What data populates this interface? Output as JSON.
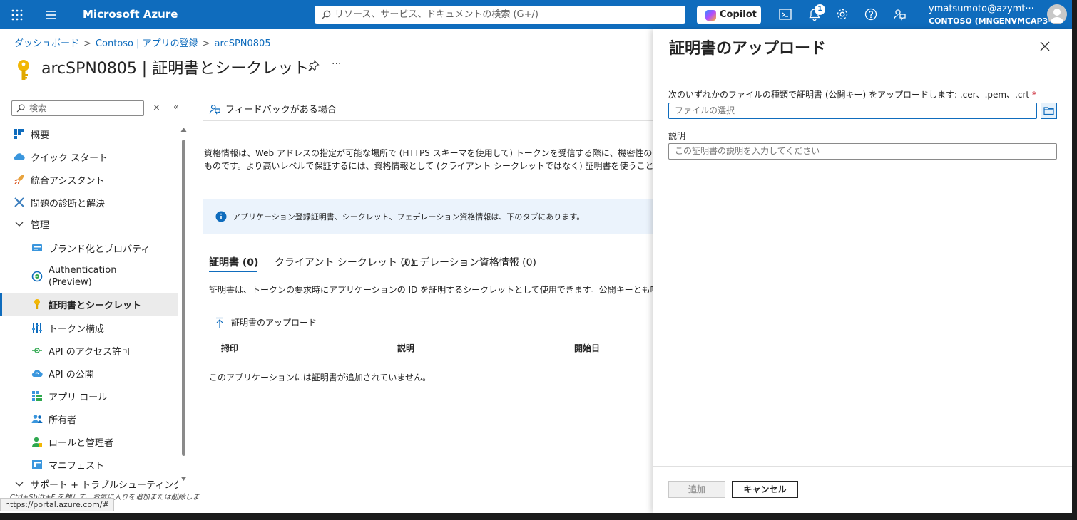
{
  "topbar": {
    "brand": "Microsoft Azure",
    "search_placeholder": "リソース、サービス、ドキュメントの検索 (G+/)",
    "copilot_label": "Copilot",
    "notification_count": "1",
    "user_name": "ymatsumoto@azymt···",
    "user_org": "CONTOSO (MNGENVMCAP3···"
  },
  "breadcrumb": {
    "items": [
      "ダッシュボード",
      "Contoso | アプリの登録",
      "arcSPN0805"
    ],
    "separator": ">"
  },
  "page": {
    "title": "arcSPN0805 | 証明書とシークレット",
    "more": "···"
  },
  "nav": {
    "search_placeholder": "検索",
    "clear": "×",
    "collapse": "«",
    "items": [
      {
        "label": "概要"
      },
      {
        "label": "クイック スタート"
      },
      {
        "label": "統合アシスタント"
      },
      {
        "label": "問題の診断と解決"
      },
      {
        "label": "管理"
      },
      {
        "label": "ブランド化とプロパティ"
      },
      {
        "label": "Authentication"
      },
      {
        "label": "(Preview)"
      },
      {
        "label": "証明書とシークレット"
      },
      {
        "label": "トークン構成"
      },
      {
        "label": "API のアクセス許可"
      },
      {
        "label": "API の公開"
      },
      {
        "label": "アプリ ロール"
      },
      {
        "label": "所有者"
      },
      {
        "label": "ロールと管理者"
      },
      {
        "label": "マニフェスト"
      },
      {
        "label": "サポート + トラブルシューティング"
      }
    ],
    "hint": "Ctrl+Shift+F を押して、お気に入りを追加または削除しま"
  },
  "statusbar": {
    "url": "https://portal.azure.com/#"
  },
  "main": {
    "feedback": "フィードバックがある場合",
    "description_line1": "資格情報は、Web アドレスの指定が可能な場所で (HTTPS スキーマを使用して) トークンを受信する際に、機密性の高いア",
    "description_line2": "ものです。より高いレベルで保証するには、資格情報として (クライアント シークレットではなく) 証明書を使うことをお勧めします。",
    "info": "アプリケーション登録証明書、シークレット、フェデレーション資格情報は、下のタブにあります。",
    "tabs": [
      "証明書 (0)",
      "クライアント シークレット (0)",
      "フェデレーション資格情報 (0)"
    ],
    "cert_description": "証明書は、トークンの要求時にアプリケーションの ID を証明するシークレットとして使用できます。公開キーとも呼ばれます。",
    "upload_label": "証明書のアップロード",
    "columns": [
      "拇印",
      "説明",
      "開始日"
    ],
    "empty_message": "このアプリケーションには証明書が追加されていません。"
  },
  "panel": {
    "title": "証明書のアップロード",
    "file_label": "次のいずれかのファイルの種類で証明書 (公開キー) をアップロードします: .cer、.pem、.crt",
    "required_mark": "*",
    "file_placeholder": "ファイルの選択",
    "desc_label": "説明",
    "desc_placeholder": "この証明書の説明を入力してください",
    "add_button": "追加",
    "cancel_button": "キャンセル"
  },
  "colors": {
    "accent": "#0f6cbd",
    "key_icon": "#f2b705"
  }
}
